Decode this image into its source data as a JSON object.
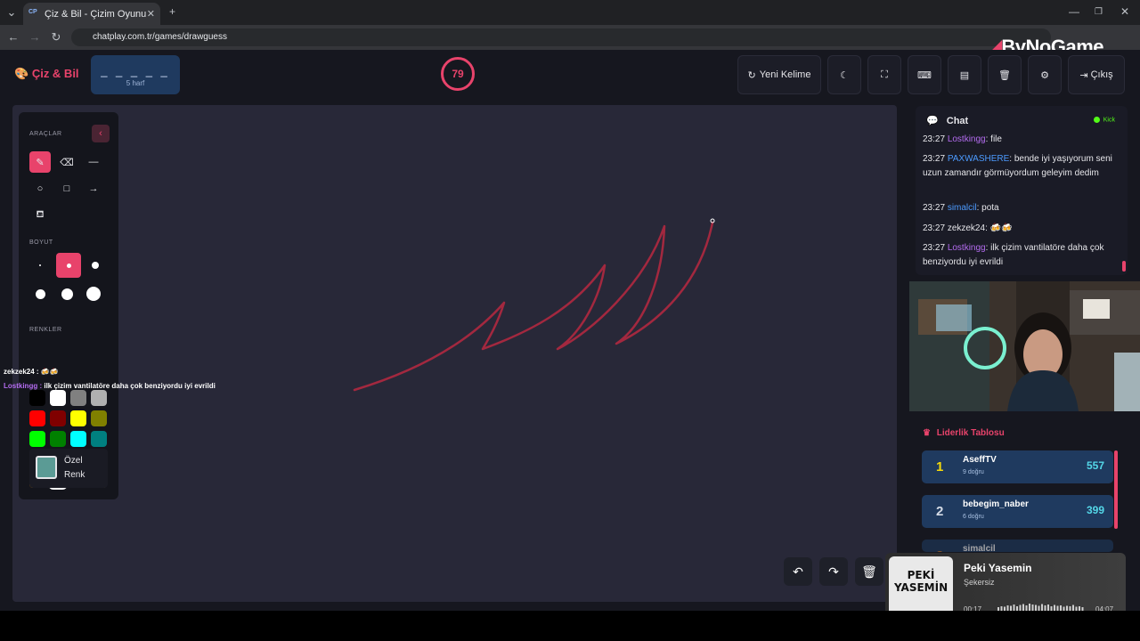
{
  "browser": {
    "tab_title": "Çiz & Bil - Çizim Oyunu",
    "favicon_text": "CP",
    "url": "chatplay.com.tr/games/drawguess"
  },
  "watermark": "ByNoGame",
  "header": {
    "brand": "Çiz & Bil",
    "word_dashes": "_ _ _ _ _",
    "word_hint": "5 harf",
    "timer": "79",
    "new_word_label": "Yeni Kelime",
    "exit_label": "Çıkış"
  },
  "tools": {
    "tools_label": "ARAÇLAR",
    "size_label": "BOYUT",
    "colors_label": "RENKLER",
    "custom_color_line1": "Özel",
    "custom_color_line2": "Renk",
    "palette": [
      "#000000",
      "#ffffff",
      "#808080",
      "#b0b0b0",
      "#ff0000",
      "#800000",
      "#ffff00",
      "#808000",
      "#00ff00",
      "#008000",
      "#00ffff",
      "#008080",
      "#0000ff",
      "#000080",
      "#ff00ff",
      "#800080",
      "#ffa500",
      "#b22234",
      "#f4a7b9",
      "#ffd700"
    ],
    "selected_color": "#b22234",
    "custom_color": "#5b9b95"
  },
  "overlay": {
    "line1_user": "zekzek24 :",
    "line1_text": "🍻🍻",
    "line2_user": "Lostkingg :",
    "line2_text": "ilk çizim vantilatöre daha çok benziyordu iyi evrildi"
  },
  "chat": {
    "title": "Chat",
    "platform": "Kick",
    "messages": [
      {
        "time": "23:27",
        "user": "Lostkingg",
        "color": "#b46cf0",
        "text": ": file"
      },
      {
        "time": "23:27",
        "user": "PAXWASHERE",
        "color": "#4c9bff",
        "text": ": bende iyi yaşıyorum seni uzun zamandır görmüyordum geleyim dedim"
      },
      {
        "time": "23:27",
        "user": "simalcil",
        "color": "#4c9bff",
        "text": ": pota"
      },
      {
        "time": "23:27",
        "user": "zekzek24",
        "color": "#e6e6ea",
        "text": ": 🍻🍻"
      },
      {
        "time": "23:27",
        "user": "Lostkingg",
        "color": "#b46cf0",
        "text": ": ilk çizim vantilatöre daha çok benziyordu iyi evrildi"
      }
    ]
  },
  "leaderboard": {
    "title": "Liderlik Tablosu",
    "rows": [
      {
        "rank": "1",
        "name": "AseffTV",
        "sub": "9 doğru",
        "score": "557",
        "rank_color": "#f5d90a"
      },
      {
        "rank": "2",
        "name": "bebegim_naber",
        "sub": "6 doğru",
        "score": "399",
        "rank_color": "#d5dbe6"
      },
      {
        "rank": "3",
        "name": "simalcil",
        "sub": "",
        "score": "",
        "rank_color": "#cd7f32"
      }
    ]
  },
  "music": {
    "song": "Peki Yasemin",
    "artist": "Şekersiz",
    "elapsed": "00:17",
    "total": "04:07",
    "album_text": "PEKİ YASEMİN"
  }
}
